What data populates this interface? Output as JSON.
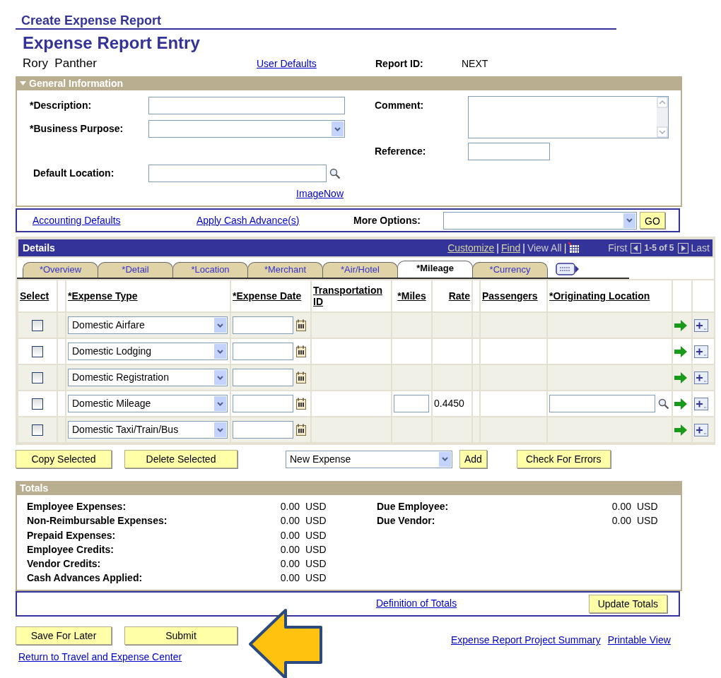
{
  "header": {
    "breadcrumb": "Create Expense Report",
    "title": "Expense Report Entry",
    "employee": "Rory  Panther",
    "user_defaults_link": "User Defaults",
    "report_id_label": "Report ID:",
    "report_id": "NEXT"
  },
  "general_information": {
    "title": "General Information",
    "expanded": true,
    "fields": [
      {
        "label": "*Description:",
        "kind": "text"
      },
      {
        "label": "*Business Purpose:",
        "kind": "select"
      },
      {
        "label": "Default Location:",
        "kind": "lookup"
      }
    ],
    "comment_label": "Comment:",
    "reference_label": "Reference:",
    "imagenow_link": "ImageNow"
  },
  "options_bar": {
    "links": [
      "Accounting Defaults",
      "Apply Cash Advance(s)"
    ],
    "more_options_label": "More Options:",
    "go_button": "GO"
  },
  "details": {
    "title": "Details",
    "customize_link": "Customize",
    "separator_1": "|",
    "find_link": "Find",
    "separator_2": "|",
    "view_all": "View All",
    "separator_3": "|",
    "first": "First",
    "range": "1-5 of 5",
    "last": "Last",
    "tabs": [
      {
        "label": "*Overview",
        "selected": false
      },
      {
        "label": "*Detail",
        "selected": false
      },
      {
        "label": "*Location",
        "selected": false
      },
      {
        "label": "*Merchant",
        "selected": false
      },
      {
        "label": "*Air/Hotel",
        "selected": false
      },
      {
        "label": "*Mileage",
        "selected": true
      },
      {
        "label": "*Currency",
        "selected": false
      }
    ],
    "columns": {
      "select": "Select",
      "expense_type": "*Expense Type",
      "expense_date": "*Expense Date",
      "transportation_id": "Transportation ID",
      "miles": "*Miles",
      "rate": "Rate",
      "passengers": "Passengers",
      "originating_location": "*Originating Location"
    },
    "rows": [
      {
        "selected": false,
        "kind": "plain",
        "expense_type": "Domestic Airfare"
      },
      {
        "selected": false,
        "kind": "plain",
        "expense_type": "Domestic Lodging"
      },
      {
        "selected": false,
        "kind": "plain",
        "expense_type": "Domestic Registration"
      },
      {
        "selected": false,
        "kind": "mileage",
        "expense_type": "Domestic Mileage",
        "rate": "0.4450"
      },
      {
        "selected": false,
        "kind": "plain",
        "expense_type": "Domestic Taxi/Train/Bus"
      }
    ]
  },
  "actions": {
    "copy_button": "Copy Selected",
    "delete_button": "Delete Selected",
    "new_expense": "New Expense",
    "add_button": "Add",
    "check_button": "Check For Errors"
  },
  "totals": {
    "title": "Totals",
    "left": [
      {
        "label": "Employee Expenses:",
        "amount": "0.00",
        "currency": "USD"
      },
      {
        "label": "Non-Reimbursable Expenses:",
        "amount": "0.00",
        "currency": "USD"
      },
      {
        "label": "Prepaid Expenses:",
        "amount": "0.00",
        "currency": "USD"
      },
      {
        "label": "Employee Credits:",
        "amount": "0.00",
        "currency": "USD"
      },
      {
        "label": "Vendor Credits:",
        "amount": "0.00",
        "currency": "USD"
      },
      {
        "label": "Cash Advances Applied:",
        "amount": "0.00",
        "currency": "USD"
      }
    ],
    "right": [
      {
        "label": "Due Employee:",
        "amount": "0.00",
        "currency": "USD"
      },
      {
        "label": "Due Vendor:",
        "amount": "0.00",
        "currency": "USD"
      }
    ],
    "definition_link": "Definition of Totals",
    "update_button": "Update Totals"
  },
  "footer": {
    "save_button": "Save For Later",
    "submit_button": "Submit",
    "links": [
      "Expense Report Project Summary",
      "Printable View"
    ],
    "return_link": "Return to Travel and Expense Center"
  }
}
